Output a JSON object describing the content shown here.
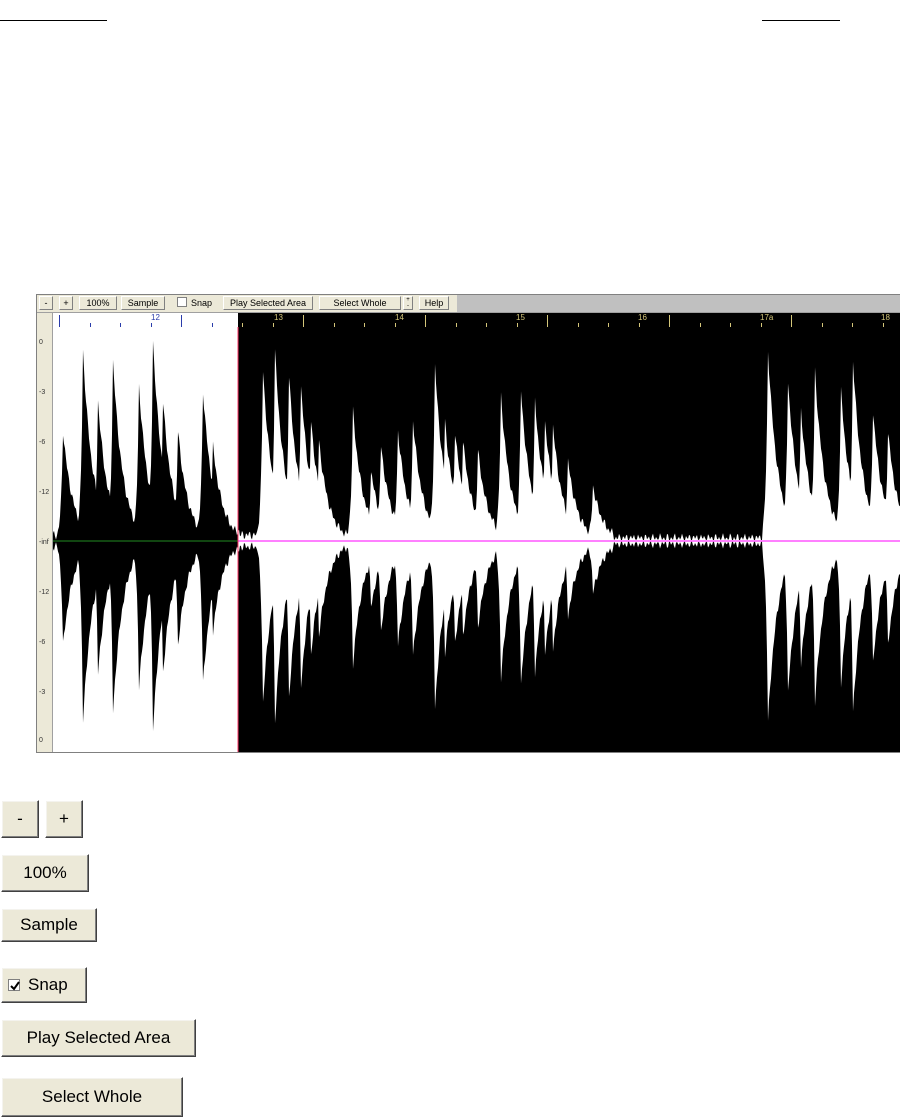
{
  "toolbar": {
    "minus": "-",
    "plus": "+",
    "zoom_100": "100%",
    "sample": "Sample",
    "snap": "Snap",
    "play_selected": "Play Selected Area",
    "select_whole": "Select Whole",
    "spin_up": "+",
    "spin_down": "-",
    "help": "Help"
  },
  "timeline": {
    "markers": [
      "12",
      "13",
      "14",
      "15",
      "16",
      "17a",
      "18"
    ]
  },
  "level_ruler": {
    "labels": [
      "0",
      "-3",
      "-6",
      "-12",
      "-inf",
      "-12",
      "-6",
      "-3",
      "0"
    ]
  },
  "legend": {
    "minus": "-",
    "plus": "+",
    "zoom_100": "100%",
    "sample": "Sample",
    "snap": "Snap",
    "play_selected": "Play Selected Area",
    "select_whole": "Select Whole"
  },
  "colors": {
    "selection_bg": "#ffffff",
    "wave_dark": "#000000",
    "wave_light": "#ffffff",
    "center_selected": "#228b22",
    "center_unselected": "#ff00ff",
    "cursor": "#ff3366",
    "ruler_ticks_selected": "#2a3caa",
    "ruler_ticks_unselected": "#d4c67a"
  },
  "snap_checked_in_legend": true
}
